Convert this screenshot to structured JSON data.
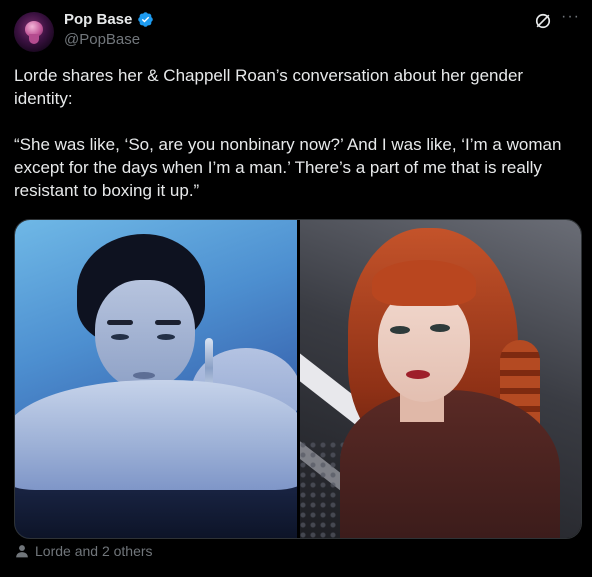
{
  "author": {
    "name": "Pop Base",
    "handle": "@PopBase",
    "verified": true,
    "avatar_icon": "pop-base-logo-icon"
  },
  "header_icons": {
    "grok": "grok-icon",
    "more": "more-options-icon",
    "more_glyph": "···"
  },
  "tweet": {
    "text": "Lorde shares her & Chappell Roan’s conversation about her gender identity:\n\n“She was like, ‘So, are you nonbinary now?’ And I was like, ‘I’m a woman except for the days when I’m a man.’ There’s a part of me that is really resistant to boxing it up.”"
  },
  "media": {
    "count": 2,
    "photos": [
      "photo-lorde",
      "photo-chappell-roan"
    ]
  },
  "tagged": {
    "icon": "person-icon",
    "text": "Lorde and 2 others"
  },
  "colors": {
    "background": "#000000",
    "text_primary": "#e7e9ea",
    "text_secondary": "#71767b",
    "verified_blue": "#1d9bf0",
    "border": "#2f3336"
  }
}
